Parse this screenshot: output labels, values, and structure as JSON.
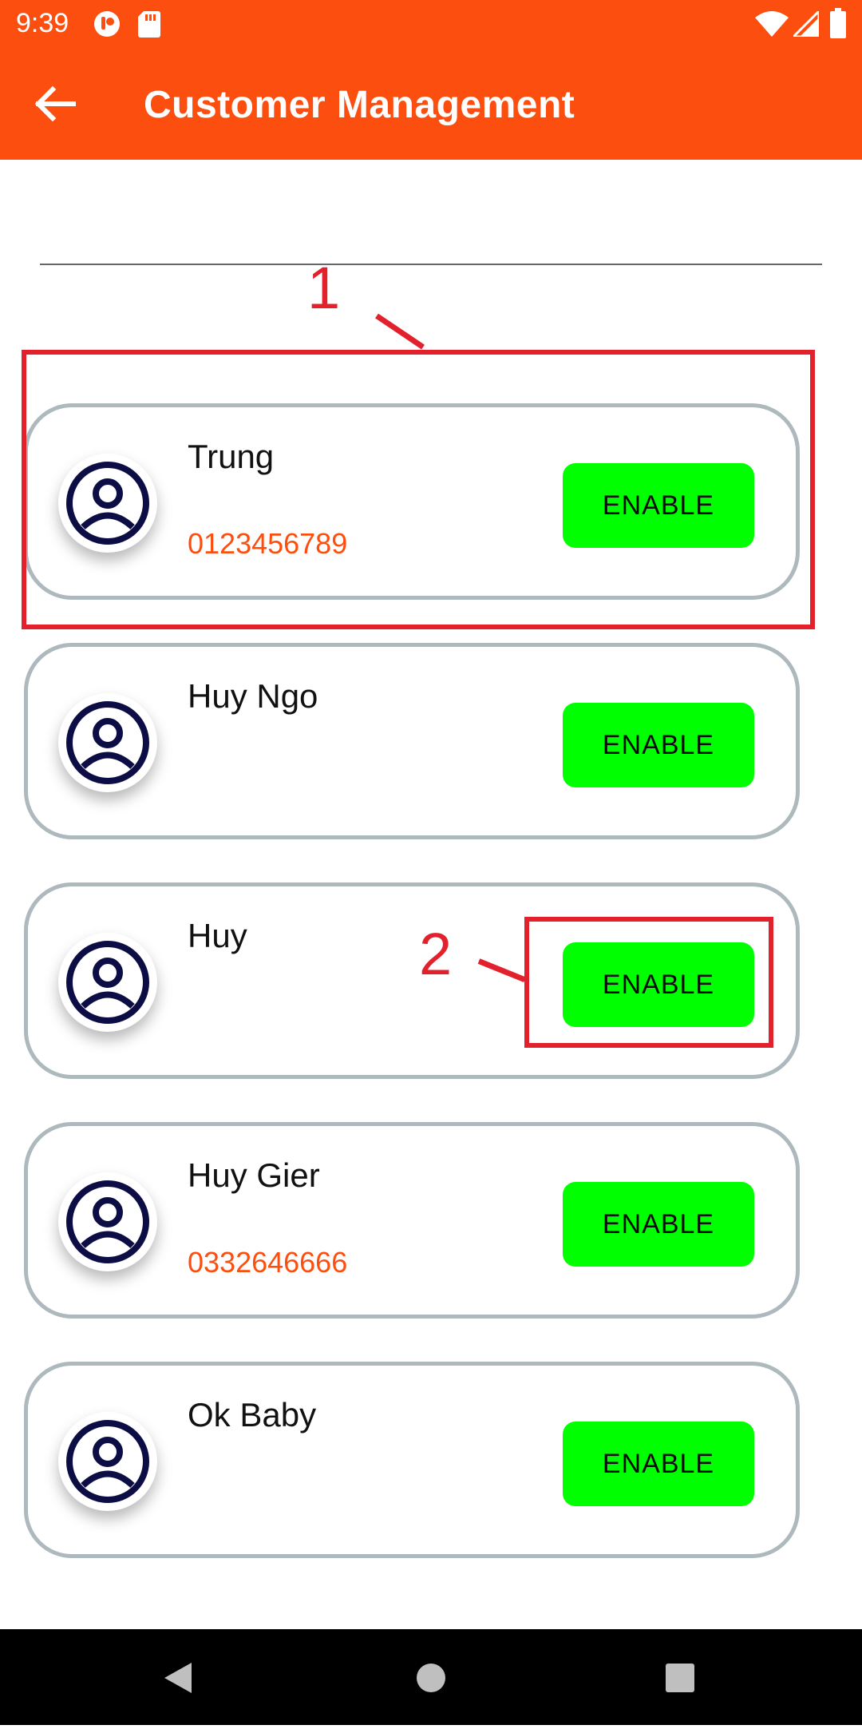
{
  "status_bar": {
    "time": "9:39",
    "icons": [
      "podcast-icon",
      "sd-card-icon",
      "wifi-icon",
      "signal-icon",
      "battery-icon"
    ]
  },
  "app_bar": {
    "title": "Customer Management",
    "back_icon": "arrow-left-icon"
  },
  "search": {
    "value": "",
    "placeholder": ""
  },
  "customers": [
    {
      "name": "Trung",
      "phone": "0123456789",
      "button_label": "ENABLE"
    },
    {
      "name": "Huy Ngo",
      "phone": "",
      "button_label": "ENABLE"
    },
    {
      "name": "Huy",
      "phone": "",
      "button_label": "ENABLE"
    },
    {
      "name": "Huy Gier",
      "phone": "0332646666",
      "button_label": "ENABLE"
    },
    {
      "name": "Ok Baby",
      "phone": "",
      "button_label": "ENABLE"
    }
  ],
  "annotations": [
    {
      "label": "1"
    },
    {
      "label": "2"
    }
  ],
  "nav_bar": {
    "icons": [
      "back-triangle-icon",
      "home-circle-icon",
      "recents-square-icon"
    ]
  },
  "colors": {
    "primary": "#fc4f0f",
    "enable_button": "#00ff00",
    "card_border": "#aeb9be",
    "annotation": "#e3212d",
    "avatar_icon": "#0d0d45"
  }
}
